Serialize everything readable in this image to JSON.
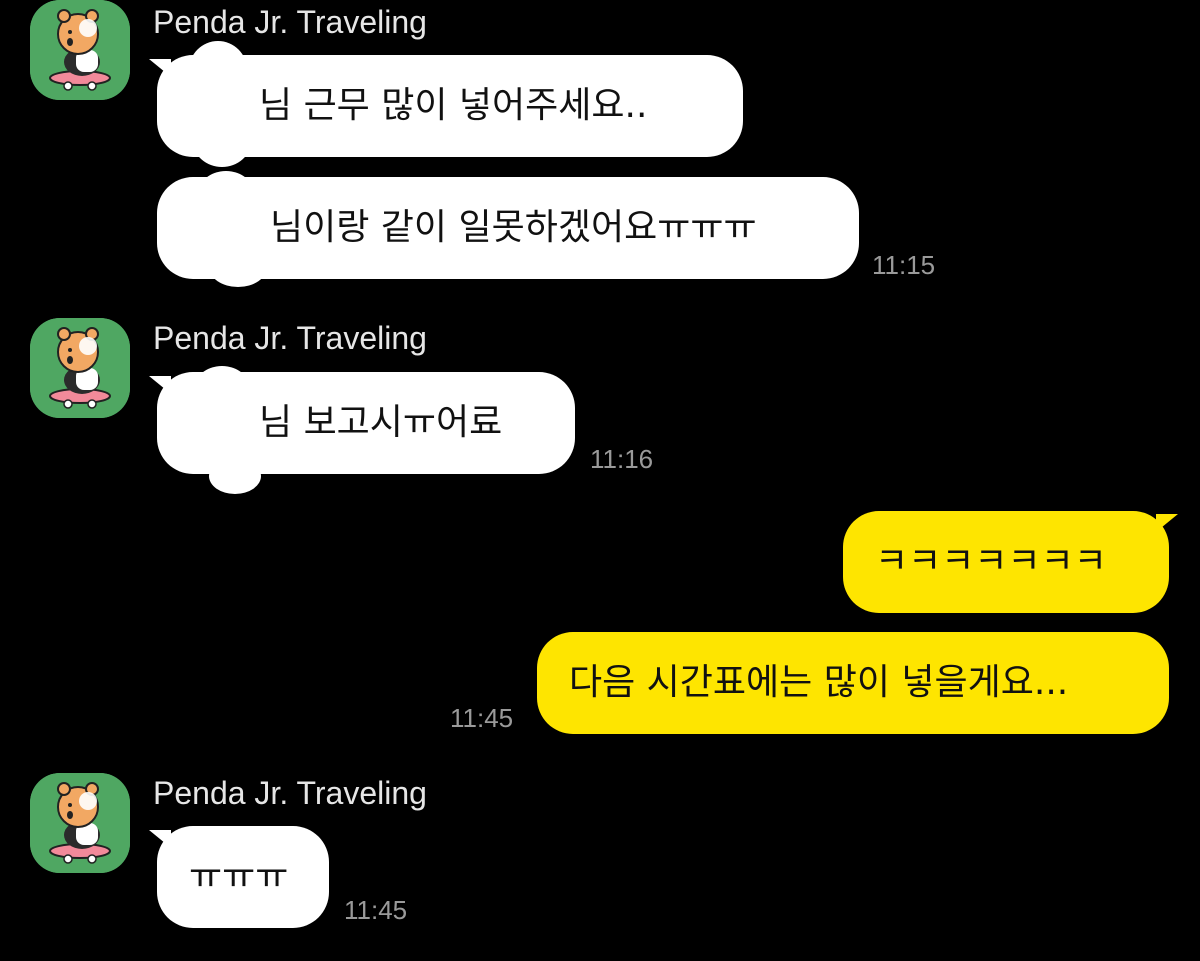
{
  "chat": {
    "groups": [
      {
        "sender": "Penda Jr. Traveling",
        "avatar_icon": "bear-on-skateboard-icon",
        "messages": [
          "님 근무 많이 넣어주세요..",
          "님이랑 같이 일못하겠어요ㅠㅠㅠ"
        ],
        "time": "11:15"
      },
      {
        "sender": "Penda Jr. Traveling",
        "avatar_icon": "bear-on-skateboard-icon",
        "messages": [
          "님 보고시ㅠ어료"
        ],
        "time": "11:16"
      },
      {
        "mine": true,
        "messages": [
          "ㅋㅋㅋㅋㅋㅋㅋ",
          "다음 시간표에는 많이 넣을게요..."
        ],
        "time": "11:45"
      },
      {
        "sender": "Penda Jr. Traveling",
        "avatar_icon": "bear-on-skateboard-icon",
        "messages": [
          "ㅠㅠㅠ"
        ],
        "time": "11:45"
      }
    ]
  },
  "colors": {
    "background": "#000000",
    "incoming_bubble": "#ffffff",
    "outgoing_bubble": "#fee500",
    "avatar_background": "#4fa762",
    "sender_name": "#e6e6e6",
    "timestamp": "#9a9a9a"
  }
}
